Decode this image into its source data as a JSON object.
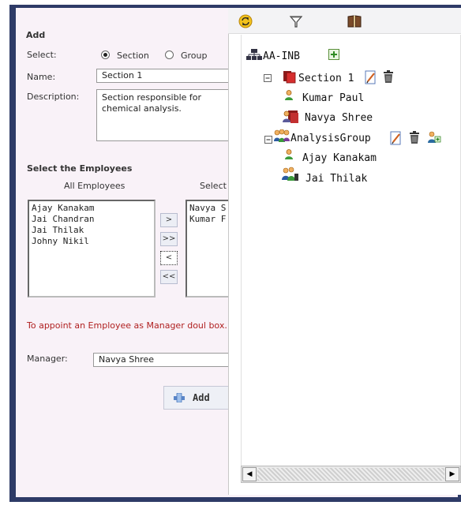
{
  "form": {
    "title": "Add",
    "select_label": "Select:",
    "radio_section": "Section",
    "radio_group": "Group",
    "name_label": "Name:",
    "name_value": "Section 1",
    "description_label": "Description:",
    "description_value": "Section responsible for chemical analysis.",
    "employees_heading": "Select the Employees",
    "all_employees_label": "All Employees",
    "selected_label": "Select",
    "all_employees": [
      "Ajay Kanakam",
      "Jai Chandran",
      "Jai Thilak",
      "Johny Nikil"
    ],
    "selected_employees": [
      "Navya S",
      "Kumar F"
    ],
    "btn_move_right": ">",
    "btn_move_all_right": ">>",
    "btn_move_left": "<",
    "btn_move_all_left": "<<",
    "manager_note": "To appoint an Employee as Manager doul box.",
    "manager_label": "Manager:",
    "manager_value": "Navya Shree",
    "add_button": "Add"
  },
  "toolbar": {
    "icons": [
      "refresh-icon",
      "filter-icon",
      "book-icon"
    ]
  },
  "tree": {
    "root": "AA-INB",
    "section": "Section 1",
    "section_members": [
      "Kumar Paul",
      "Navya Shree"
    ],
    "group": "AnalysisGroup",
    "group_members": [
      "Ajay Kanakam",
      "Jai Thilak"
    ]
  },
  "colors": {
    "frame": "#2e3b67",
    "form_bg": "#f9f2f8",
    "note_red": "#b02020"
  }
}
